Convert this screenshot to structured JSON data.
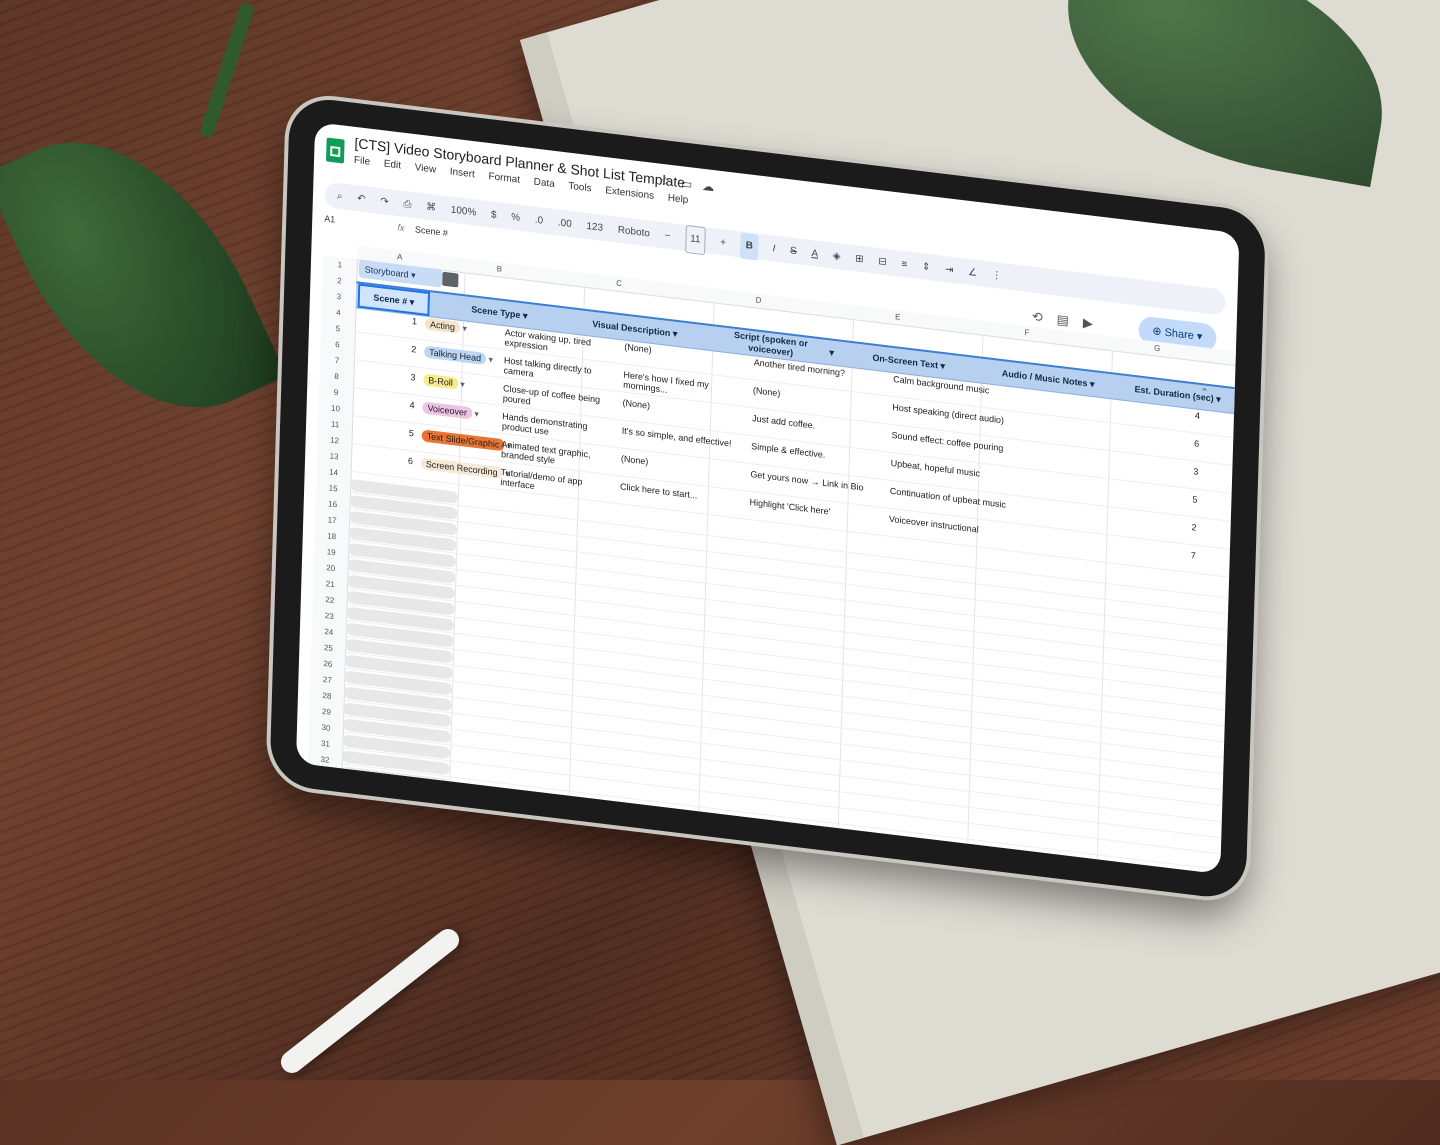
{
  "app": {
    "title": "[CTS] Video Storyboard Planner & Shot List Template",
    "menu": [
      "File",
      "Edit",
      "View",
      "Insert",
      "Format",
      "Data",
      "Tools",
      "Extensions",
      "Help"
    ],
    "share_label": "Share"
  },
  "toolbar": {
    "zoom": "100%",
    "currency": "$",
    "percent": "%",
    "dec_decrease": ".0",
    "dec_increase": ".00",
    "number_format": "123",
    "font": "Roboto",
    "font_size": "11",
    "bold": "B",
    "italic": "I",
    "strike": "S",
    "text_color": "A"
  },
  "formula_bar": {
    "cell_ref": "A1",
    "fx": "fx",
    "value": "Scene #"
  },
  "grid": {
    "columns": [
      "A",
      "B",
      "C",
      "D",
      "E",
      "F",
      "G"
    ],
    "sheet_tab": "Storyboard",
    "headers": {
      "scene_num": "Scene #",
      "scene_type": "Scene Type",
      "visual": "Visual Description",
      "script": "Script (spoken or voiceover)",
      "onscreen": "On-Screen Text",
      "audio": "Audio / Music Notes",
      "duration": "Est. Duration (sec)"
    },
    "rows": [
      {
        "num": "1",
        "type": "Acting",
        "visual": "Actor waking up, tired expression",
        "script": "(None)",
        "onscreen": "Another tired morning?",
        "audio": "Calm background music",
        "duration": "4"
      },
      {
        "num": "2",
        "type": "Talking Head",
        "visual": "Host talking directly to camera",
        "script": "Here's how I fixed my mornings...",
        "onscreen": "(None)",
        "audio": "Host speaking (direct audio)",
        "duration": "6"
      },
      {
        "num": "3",
        "type": "B-Roll",
        "visual": "Close-up of coffee being poured",
        "script": "(None)",
        "onscreen": "Just add coffee.",
        "audio": "Sound effect: coffee pouring",
        "duration": "3"
      },
      {
        "num": "4",
        "type": "Voiceover",
        "visual": "Hands demonstrating product use",
        "script": "It's so simple, and effective!",
        "onscreen": "Simple & effective.",
        "audio": "Upbeat, hopeful music",
        "duration": "5"
      },
      {
        "num": "5",
        "type": "Text Slide/Graphic",
        "visual": "Animated text graphic, branded style",
        "script": "(None)",
        "onscreen": "Get yours now → Link in Bio",
        "audio": "Continuation of upbeat music",
        "duration": "2"
      },
      {
        "num": "6",
        "type": "Screen Recording",
        "visual": "Tutorial/demo of app interface",
        "script": "Click here to start...",
        "onscreen": "Highlight 'Click here'",
        "audio": "Voiceover instructional",
        "duration": "7"
      }
    ],
    "chip_colors": {
      "Acting": "#f3e6c8",
      "Talking Head": "#bcd6f5",
      "B-Roll": "#f7ec8a",
      "Voiceover": "#ecc3e2",
      "Text Slide/Graphic": "#e87434",
      "Screen Recording": "#f6e9d6"
    },
    "row_numbers": [
      "1",
      "2",
      "3",
      "4",
      "5",
      "6",
      "7",
      "8",
      "9",
      "10",
      "11",
      "12",
      "13",
      "14",
      "15",
      "16",
      "17",
      "18",
      "19",
      "20",
      "21",
      "22",
      "23",
      "24",
      "25",
      "26",
      "27",
      "28",
      "29",
      "30",
      "31",
      "32"
    ]
  }
}
